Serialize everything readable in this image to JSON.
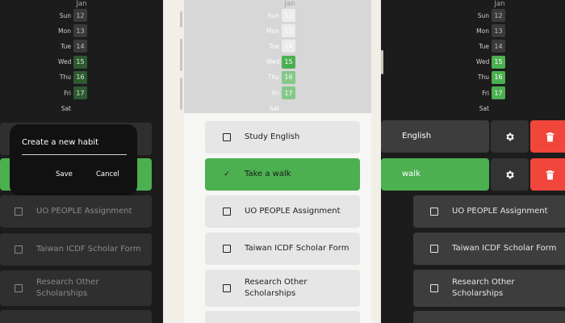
{
  "calendar": {
    "month": "Jan",
    "rows": [
      {
        "day": "Sun",
        "date": "12",
        "done": false
      },
      {
        "day": "Mon",
        "date": "13",
        "done": false
      },
      {
        "day": "Tue",
        "date": "14",
        "done": false
      },
      {
        "day": "Wed",
        "date": "15",
        "done": true
      },
      {
        "day": "Thu",
        "date": "16",
        "done": true
      },
      {
        "day": "Fri",
        "date": "17",
        "done": true
      },
      {
        "day": "Sat",
        "date": "",
        "done": false
      }
    ]
  },
  "habits": [
    {
      "name": "Study English",
      "done": false
    },
    {
      "name": "Take a walk",
      "done": true
    },
    {
      "name": "UO PEOPLE Assignment",
      "done": false
    },
    {
      "name": "Taiwan ICDF Scholar Form",
      "done": false
    },
    {
      "name": "Research Other Scholarships",
      "done": false
    }
  ],
  "swipe_partial": {
    "study_english": "English",
    "take_a_walk": "walk"
  },
  "dialog": {
    "title": "Create a new habit",
    "save": "Save",
    "cancel": "Cancel"
  },
  "icons": {
    "check": "check-icon",
    "settings": "gear-icon",
    "delete": "trash-icon"
  },
  "colors": {
    "done_green": "#4caf50",
    "delete_red": "#f0463c",
    "dark_bg": "#1c1c1c"
  }
}
